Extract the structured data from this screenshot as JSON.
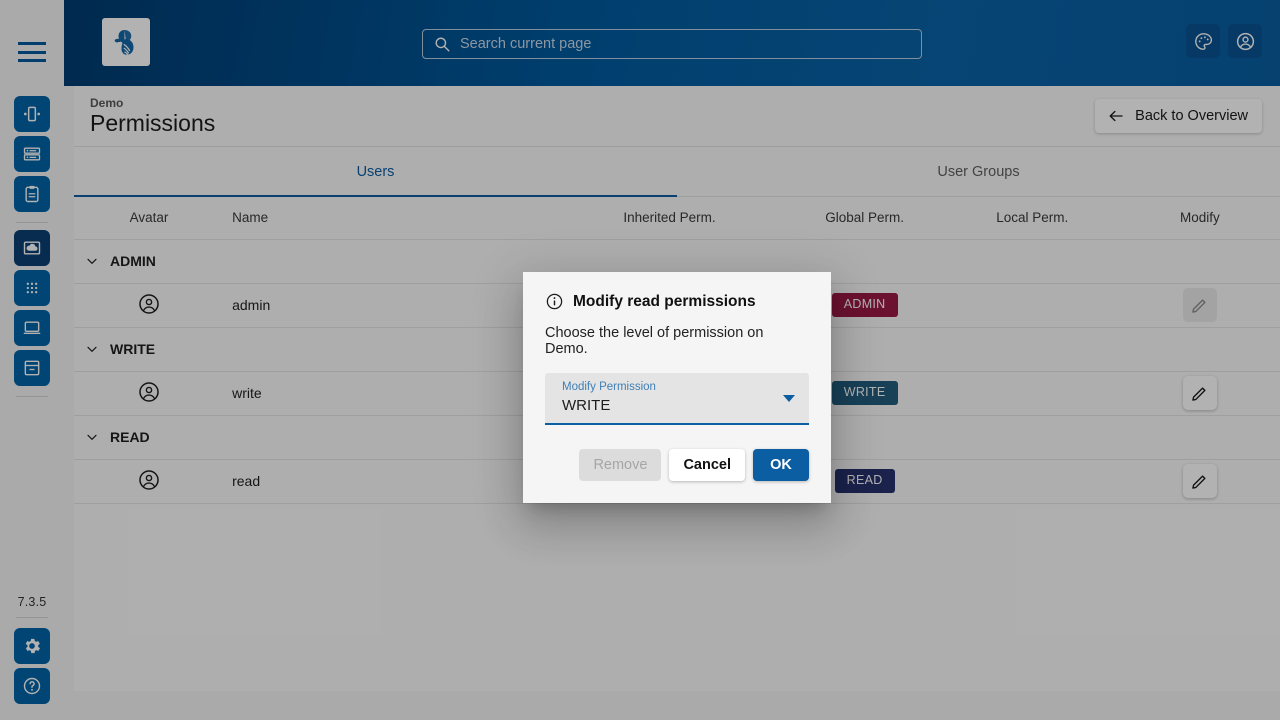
{
  "app": {
    "logo_icon": "bee-logo-icon",
    "version": "7.3.5"
  },
  "search": {
    "placeholder": "Search current page",
    "value": "",
    "icon": "search-icon"
  },
  "appbar": {
    "theme_icon": "palette-icon",
    "account_icon": "account-circle-icon"
  },
  "sidebar": {
    "menu_icon": "hamburger-menu-icon",
    "items": [
      {
        "icon": "device-view-icon",
        "active": false
      },
      {
        "icon": "list-icon",
        "active": false
      },
      {
        "icon": "clipboard-icon",
        "active": false
      },
      {
        "icon": "cloud-upload-icon",
        "active": true
      },
      {
        "icon": "apps-grid-icon",
        "active": false
      },
      {
        "icon": "monitor-icon",
        "active": false
      },
      {
        "icon": "archive-icon",
        "active": false
      }
    ],
    "settings_icon": "gear-icon",
    "help_icon": "help-circle-icon"
  },
  "page": {
    "breadcrumb": "Demo",
    "title": "Permissions",
    "back_label": "Back to Overview",
    "back_icon": "arrow-left-icon"
  },
  "tabs": [
    {
      "label": "Users",
      "active": true
    },
    {
      "label": "User Groups",
      "active": false
    }
  ],
  "table": {
    "headers": [
      "Avatar",
      "Name",
      "Inherited Perm.",
      "Global Perm.",
      "Local Perm.",
      "Modify"
    ],
    "groups": [
      {
        "label": "ADMIN",
        "chevron_icon": "chevron-down-icon",
        "rows": [
          {
            "avatar_icon": "account-circle-icon",
            "name": "admin",
            "inherited": "",
            "global": "ADMIN",
            "global_color": "#9b1b46",
            "local": "",
            "modify_icon": "pencil-icon",
            "modify_disabled": true
          }
        ]
      },
      {
        "label": "WRITE",
        "chevron_icon": "chevron-down-icon",
        "rows": [
          {
            "avatar_icon": "account-circle-icon",
            "name": "write",
            "inherited": "",
            "global": "WRITE",
            "global_color": "#235d7f",
            "local": "",
            "modify_icon": "pencil-icon",
            "modify_disabled": false
          }
        ]
      },
      {
        "label": "READ",
        "chevron_icon": "chevron-down-icon",
        "rows": [
          {
            "avatar_icon": "account-circle-icon",
            "name": "read",
            "inherited": "",
            "global": "READ",
            "global_color": "#27316e",
            "local": "",
            "modify_icon": "pencil-icon",
            "modify_disabled": false
          }
        ]
      }
    ]
  },
  "dialog": {
    "info_icon": "info-circle-icon",
    "title": "Modify read permissions",
    "body": "Choose the level of permission on Demo.",
    "select": {
      "label": "Modify Permission",
      "value": "WRITE",
      "caret_icon": "chevron-down-icon"
    },
    "buttons": {
      "remove": "Remove",
      "cancel": "Cancel",
      "ok": "OK"
    }
  },
  "colors": {
    "brand_blue": "#0c5ea3",
    "rail_blue": "#0063a6",
    "rail_blue_active": "#0b3f73",
    "admin_badge": "#9b1b46",
    "write_badge": "#235d7f",
    "read_badge": "#27316e"
  }
}
